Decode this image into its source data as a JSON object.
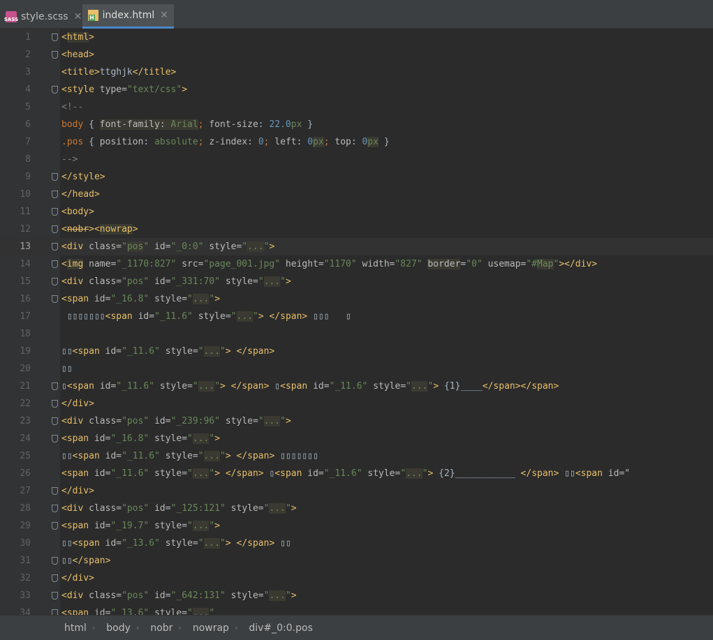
{
  "tabs": [
    {
      "label": "style.scss",
      "icon": "sass-file-icon",
      "active": false
    },
    {
      "label": "index.html",
      "icon": "html-file-icon",
      "active": true
    }
  ],
  "colors": {
    "tag": "#e8bf6a",
    "string": "#6a8759",
    "comment": "#808080",
    "number": "#6897bb",
    "accent": "#4a88c7"
  },
  "editor": {
    "current_line": 13,
    "lines": [
      {
        "n": "1"
      },
      {
        "n": "2"
      },
      {
        "n": "3"
      },
      {
        "n": "4"
      },
      {
        "n": "5"
      },
      {
        "n": "6"
      },
      {
        "n": "7"
      },
      {
        "n": "8"
      },
      {
        "n": "9"
      },
      {
        "n": "10"
      },
      {
        "n": "11"
      },
      {
        "n": "12"
      },
      {
        "n": "13"
      },
      {
        "n": "14"
      },
      {
        "n": "15"
      },
      {
        "n": "16"
      },
      {
        "n": "17"
      },
      {
        "n": "18"
      },
      {
        "n": "19"
      },
      {
        "n": "20"
      },
      {
        "n": "21"
      },
      {
        "n": "22"
      },
      {
        "n": "23"
      },
      {
        "n": "24"
      },
      {
        "n": "25"
      },
      {
        "n": "26"
      },
      {
        "n": "27"
      },
      {
        "n": "28"
      },
      {
        "n": "29"
      },
      {
        "n": "30"
      },
      {
        "n": "31"
      },
      {
        "n": "32"
      },
      {
        "n": "33"
      },
      {
        "n": "34"
      }
    ]
  },
  "breadcrumbs": [
    "html",
    "body",
    "nobr",
    "nowrap",
    "div#_0:0.pos"
  ]
}
